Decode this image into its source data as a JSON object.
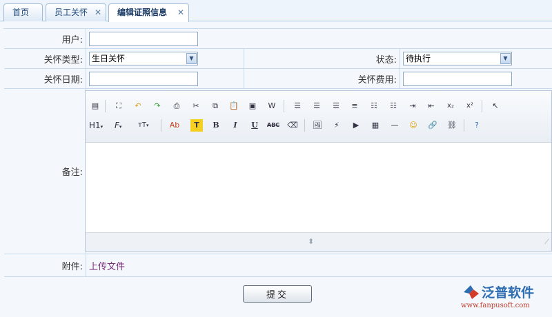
{
  "tabs": [
    {
      "label": "首页",
      "closable": false,
      "active": false
    },
    {
      "label": "员工关怀",
      "closable": true,
      "active": false
    },
    {
      "label": "编辑证照信息",
      "closable": true,
      "active": true
    }
  ],
  "form": {
    "user_label": "用户:",
    "user_value": "",
    "care_type_label": "关怀类型:",
    "care_type_value": "生日关怀",
    "status_label": "状态:",
    "status_value": "待执行",
    "care_date_label": "关怀日期:",
    "care_date_value": "",
    "care_cost_label": "关怀费用:",
    "care_cost_value": "",
    "remark_label": "备注:",
    "attachment_label": "附件:",
    "upload_link": "上传文件"
  },
  "toolbar": {
    "heading": "H1",
    "font_family": "F",
    "font_size": "тT",
    "text_color": "Ab",
    "bg_color": "T",
    "bold": "B",
    "italic": "I",
    "underline": "U",
    "strikethrough": "ABC",
    "subscript": "x₂",
    "superscript": "x²"
  },
  "submit_label": "提交",
  "brand": {
    "name": "泛普软件",
    "url": "www.fanpusoft.com",
    "accent": "#2f6db3"
  }
}
